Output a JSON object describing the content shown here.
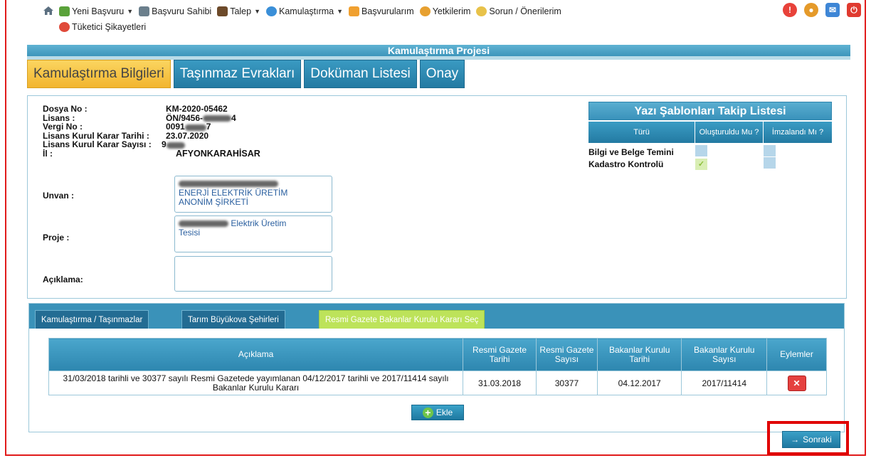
{
  "nav": {
    "row1": [
      {
        "label": "Yeni Başvuru",
        "icon": "new-application-icon",
        "dropdown": true,
        "color": "#5aa23a"
      },
      {
        "label": "Başvuru Sahibi",
        "icon": "applicant-icon",
        "dropdown": false,
        "color": "#6b7f8c"
      },
      {
        "label": "Talep",
        "icon": "request-icon",
        "dropdown": true,
        "color": "#6d4a2a"
      },
      {
        "label": "Kamulaştırma",
        "icon": "globe-icon",
        "dropdown": true,
        "color": "#3a8fd8"
      },
      {
        "label": "Başvurularım",
        "icon": "folder-icon",
        "dropdown": false,
        "color": "#f0a030"
      },
      {
        "label": "Yetkilerim",
        "icon": "users-icon",
        "dropdown": false,
        "color": "#e7a030"
      },
      {
        "label": "Sorun / Önerilerim",
        "icon": "speech-icon",
        "dropdown": false,
        "color": "#e8c24a"
      }
    ],
    "row2": [
      {
        "label": "Tüketici Şikayetleri",
        "icon": "complaint-icon",
        "color": "#e04a3a"
      }
    ]
  },
  "title": "Kamulaştırma Projesi",
  "main_tabs": [
    "Kamulaştırma Bilgileri",
    "Taşınmaz Evrakları",
    "Doküman Listesi",
    "Onay"
  ],
  "info": {
    "dosya_no_label": "Dosya No :",
    "dosya_no": "KM-2020-05462",
    "lisans_label": "Lisans :",
    "lisans": "ÖN/9456-",
    "lisans_tail": "4",
    "vergi_label": "Vergi No :",
    "vergi": "0091",
    "vergi_tail": "7",
    "karar_tarihi_label": "Lisans Kurul Karar Tarihi :",
    "karar_tarihi": "23.07.2020",
    "karar_sayisi_label": "Lisans Kurul Karar Sayısı :",
    "karar_sayisi": "9",
    "il_label": "İl :",
    "il": "AFYONKARAHİSAR",
    "unvan_label": "Unvan :",
    "unvan_line1": "ENERJİ ELEKTRİK ÜRETİM",
    "unvan_line2": "ANONİM ŞİRKETİ",
    "proje_label": "Proje :",
    "proje_line1": "Elektrik Üretim",
    "proje_line2": "Tesisi",
    "aciklama_label": "Açıklama:",
    "aciklama_value": ""
  },
  "yazi": {
    "title": "Yazı Şablonları Takip Listesi",
    "headers": [
      "Türü",
      "Oluşturuldu Mu ?",
      "İmzalandı Mı ?"
    ],
    "rows": [
      {
        "label": "Bilgi ve Belge Temini",
        "olusturuldu": false,
        "imzalandi": false
      },
      {
        "label": "Kadastro Kontrolü",
        "olusturuldu": true,
        "imzalandi": false
      }
    ]
  },
  "bottom_tabs": [
    "Kamulaştırma / Taşınmazlar",
    "Tarım Büyükova Şehirleri",
    "Resmi Gazete Bakanlar Kurulu Kararı Seç"
  ],
  "gazete": {
    "headers": [
      "Açıklama",
      "Resmi Gazete Tarihi",
      "Resmi Gazete Sayısı",
      "Bakanlar Kurulu Tarihi",
      "Bakanlar Kurulu Sayısı",
      "Eylemler"
    ],
    "rows": [
      {
        "aciklama": "31/03/2018 tarihli ve 30377 sayılı Resmi Gazetede yayımlanan 04/12/2017 tarihli ve 2017/11414 sayılı Bakanlar Kurulu Kararı",
        "rg_tarihi": "31.03.2018",
        "rg_sayisi": "30377",
        "bk_tarihi": "04.12.2017",
        "bk_sayisi": "2017/11414"
      }
    ],
    "ekle": "Ekle"
  },
  "sonraki": "Sonraki",
  "colors": {
    "accent": "#3a92b9",
    "active_tab": "#f7c64a",
    "highlight_border": "#e00000"
  }
}
